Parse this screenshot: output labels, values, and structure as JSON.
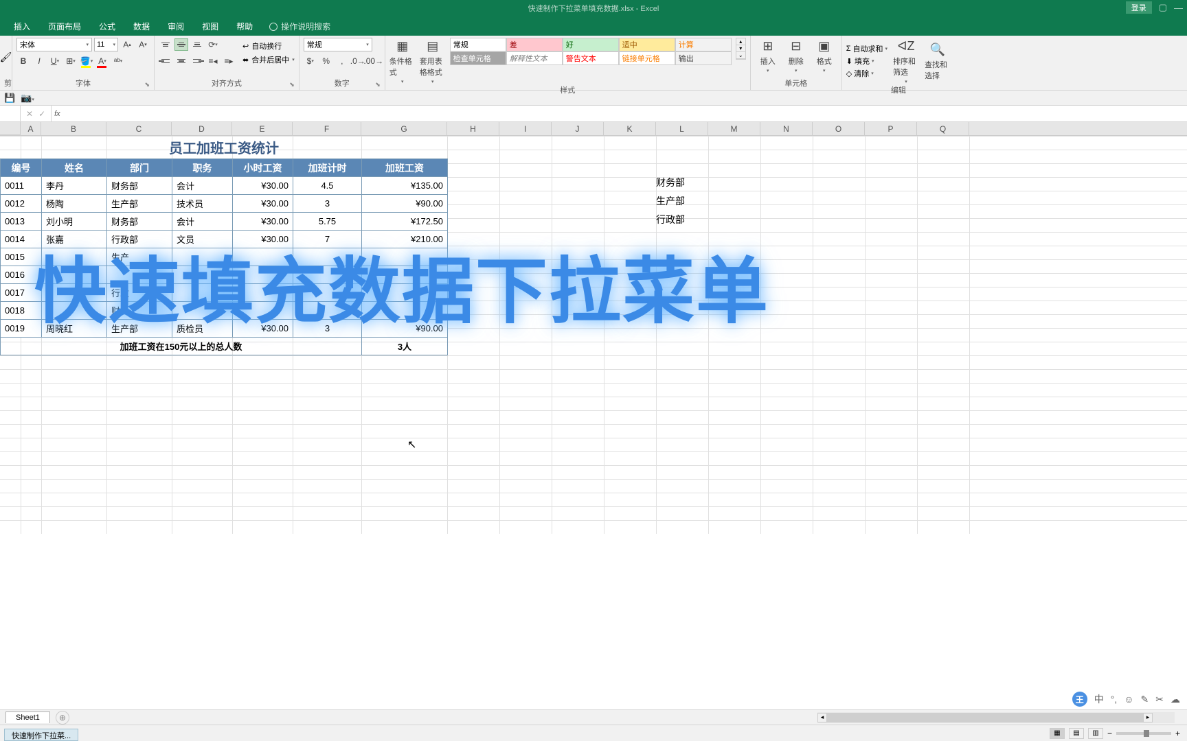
{
  "titlebar": {
    "title": "快速制作下拉菜单填充数据.xlsx - Excel",
    "login": "登录"
  },
  "tabs": {
    "insert": "插入",
    "layout": "页面布局",
    "formula": "公式",
    "data": "数据",
    "review": "审阅",
    "view": "视图",
    "help": "帮助",
    "search": "操作说明搜索"
  },
  "ribbon": {
    "clipboard": {
      "label": "剪"
    },
    "font": {
      "label": "字体",
      "name": "宋体",
      "size": "11"
    },
    "alignment": {
      "label": "对齐方式",
      "wrap": "自动换行",
      "merge": "合并后居中"
    },
    "number": {
      "label": "数字",
      "format": "常规"
    },
    "styles": {
      "label": "样式",
      "cond": "条件格式",
      "table": "套用表格格式",
      "normal": "常规",
      "bad": "差",
      "good": "好",
      "neutral": "适中",
      "calc": "计算",
      "check": "检查单元格",
      "explain": "解释性文本",
      "warn": "警告文本",
      "link": "链接单元格",
      "output": "输出"
    },
    "cells": {
      "label": "单元格",
      "insert": "插入",
      "delete": "删除",
      "format": "格式"
    },
    "editing": {
      "label": "编辑",
      "autosum": "自动求和",
      "fill": "填充",
      "clear": "清除",
      "sort": "排序和筛选",
      "find": "查找和选择"
    }
  },
  "cols": [
    "A",
    "B",
    "C",
    "D",
    "E",
    "F",
    "G",
    "H",
    "I",
    "J",
    "K",
    "L",
    "M",
    "N",
    "O",
    "P",
    "Q"
  ],
  "table": {
    "title": "员工加班工资统计",
    "headers": [
      "编号",
      "姓名",
      "部门",
      "职务",
      "小时工资",
      "加班计时",
      "加班工资"
    ],
    "rows": [
      [
        "0011",
        "李丹",
        "财务部",
        "会计",
        "¥30.00",
        "4.5",
        "¥135.00"
      ],
      [
        "0012",
        "杨陶",
        "生产部",
        "技术员",
        "¥30.00",
        "3",
        "¥90.00"
      ],
      [
        "0013",
        "刘小明",
        "财务部",
        "会计",
        "¥30.00",
        "5.75",
        "¥172.50"
      ],
      [
        "0014",
        "张嘉",
        "行政部",
        "文员",
        "¥30.00",
        "7",
        "¥210.00"
      ],
      [
        "0015",
        "",
        "生产",
        "",
        "",
        "",
        ""
      ],
      [
        "0016",
        "",
        "",
        "",
        "",
        "",
        ""
      ],
      [
        "0017",
        "",
        "行政",
        "",
        "",
        "",
        ""
      ],
      [
        "0018",
        "",
        "财",
        "",
        "",
        "",
        ""
      ],
      [
        "0019",
        "周晓红",
        "生产部",
        "质检员",
        "¥30.00",
        "3",
        "¥90.00"
      ]
    ],
    "summary_label": "加班工资在150元以上的总人数",
    "summary_value": "3人"
  },
  "side_list": [
    "财务部",
    "生产部",
    "行政部"
  ],
  "overlay": "快速填充数据下拉菜单",
  "sheet": {
    "name": "Sheet1"
  },
  "taskbar": {
    "item": "快速制作下拉菜..."
  },
  "tray": {
    "ime": "中"
  }
}
